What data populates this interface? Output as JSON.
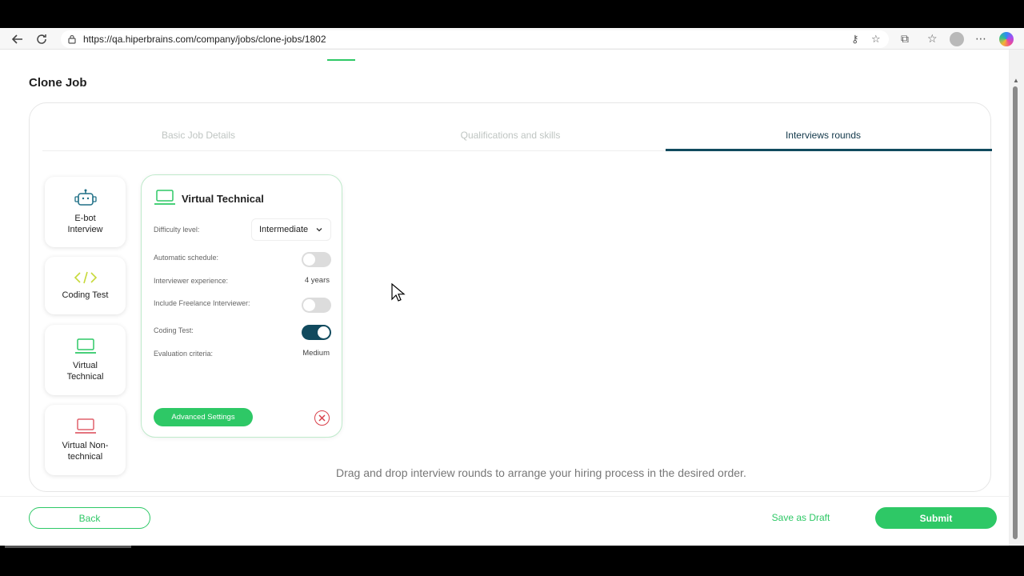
{
  "browser": {
    "url": "https://qa.hiperbrains.com/company/jobs/clone-jobs/1802",
    "icons": [
      "back-icon",
      "reload-icon",
      "lock-icon",
      "key-icon",
      "star-icon",
      "extensions-icon",
      "favorites-icon",
      "profile-avatar",
      "more-icon",
      "copilot-icon"
    ]
  },
  "page": {
    "title": "Clone Job"
  },
  "tabs": [
    {
      "label": "Basic Job Details",
      "active": false
    },
    {
      "label": "Qualifications and skills",
      "active": false
    },
    {
      "label": "Interviews rounds",
      "active": true
    }
  ],
  "rounds": [
    {
      "label": "E-bot Interview",
      "icon": "robot-icon",
      "color": "#1e6f86"
    },
    {
      "label": "Coding Test",
      "icon": "code-icon",
      "color": "#c7d93a"
    },
    {
      "label": "Virtual Technical",
      "icon": "laptop-icon",
      "color": "#2ec866"
    },
    {
      "label": "Virtual Non-technical",
      "icon": "laptop-icon",
      "color": "#e0606b"
    }
  ],
  "selected_round": {
    "title": "Virtual Technical",
    "difficulty_label": "Difficulty level:",
    "difficulty_value": "Intermediate",
    "auto_schedule_label": "Automatic schedule:",
    "auto_schedule_on": false,
    "interviewer_exp_label": "Interviewer experience:",
    "interviewer_exp_value": "4 years",
    "freelance_label": "Include Freelance Interviewer:",
    "freelance_on": false,
    "coding_test_label": "Coding Test:",
    "coding_test_on": true,
    "evaluation_label": "Evaluation criteria:",
    "evaluation_value": "Medium",
    "advanced_label": "Advanced Settings"
  },
  "hint": "Drag and drop interview rounds to arrange your hiring process in the desired order.",
  "footer": {
    "back_label": "Back",
    "draft_label": "Save as Draft",
    "submit_label": "Submit"
  },
  "colors": {
    "accent": "#2ec866",
    "primary_dark": "#114a5e",
    "danger": "#d9404a"
  }
}
